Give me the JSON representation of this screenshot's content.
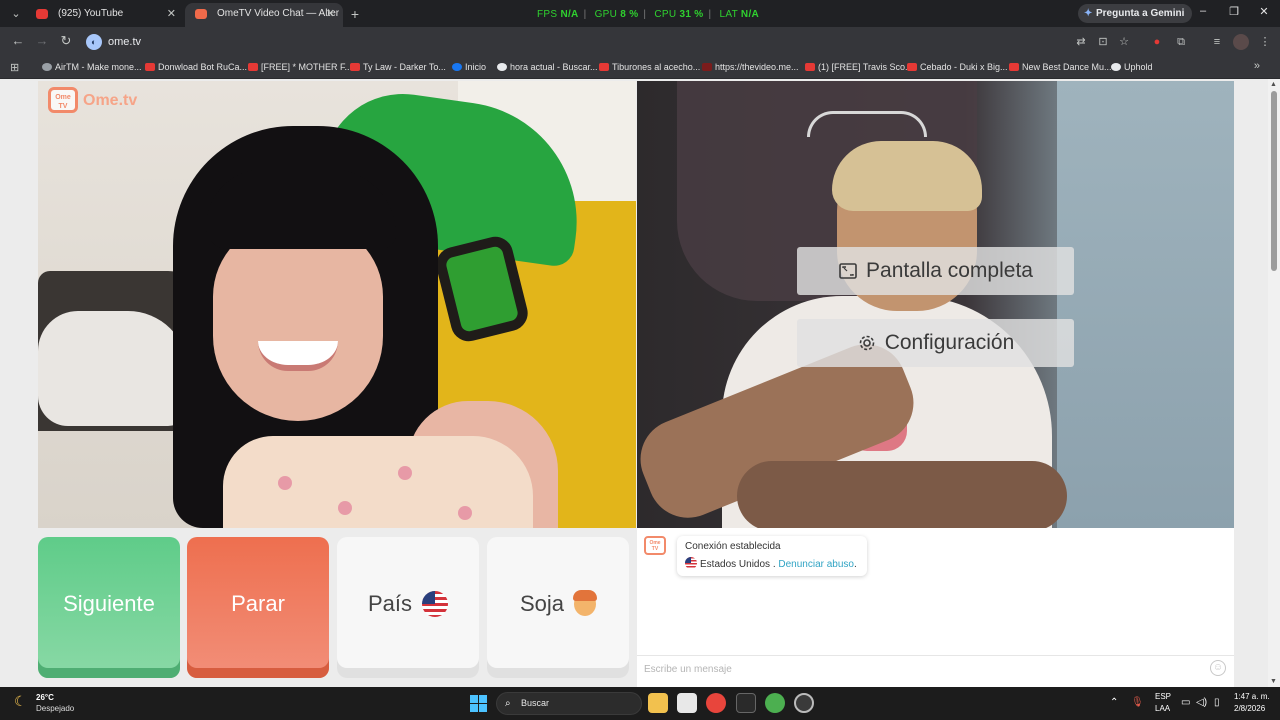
{
  "browser": {
    "tabs": [
      {
        "title": "(925) YouTube",
        "active": false,
        "favicon_color": "#e53935"
      },
      {
        "title": "OmeTV Video Chat — Alter",
        "active": true,
        "favicon_color": "#f06a4a"
      }
    ],
    "new_tab": "+",
    "perf": {
      "fps_label": "FPS",
      "fps": "N/A",
      "gpu_label": "GPU",
      "gpu": "8 %",
      "cpu_label": "CPU",
      "cpu": "31 %",
      "lat_label": "LAT",
      "lat": "N/A",
      "color": "#2fd12f"
    },
    "gemini_label": "Pregunta a Gemini",
    "url": "ome.tv",
    "bookmarks": [
      "AirTM - Make mone...",
      "Donwload Bot RuCa...",
      "[FREE] * MOTHER F...",
      "Ty Law - Darker To...",
      "Inicio",
      "hora actual - Buscar...",
      "Tiburones al acecho...",
      "https://thevideo.me...",
      "(1) [FREE] Travis Sco...",
      "Cebado - Duki x Big...",
      "New Best Dance Mu...",
      "Uphold"
    ]
  },
  "site": {
    "logo_text": "Ome.tv",
    "logo_badge": "Ome TV",
    "overlay": {
      "fullscreen_label": "Pantalla completa",
      "settings_label": "Configuración"
    },
    "buttons": {
      "next": "Siguiente",
      "stop": "Parar",
      "country": "País",
      "gender": "Soja"
    },
    "colors": {
      "next": "#5fcc89",
      "stop": "#ee6f4f",
      "link": "#31a4c4"
    },
    "chat": {
      "status": "Conexión establecida",
      "country": "Estados Unidos .",
      "report_link": "Denunciar abuso",
      "report_suffix": ".",
      "input_placeholder": "Escribe un mensaje"
    }
  },
  "taskbar": {
    "weather_temp": "26°C",
    "weather_desc": "Despejado",
    "search_placeholder": "Buscar",
    "lang_line1": "ESP",
    "lang_line2": "LAA",
    "time": "1:47 a. m.",
    "date": "2/8/2026"
  }
}
